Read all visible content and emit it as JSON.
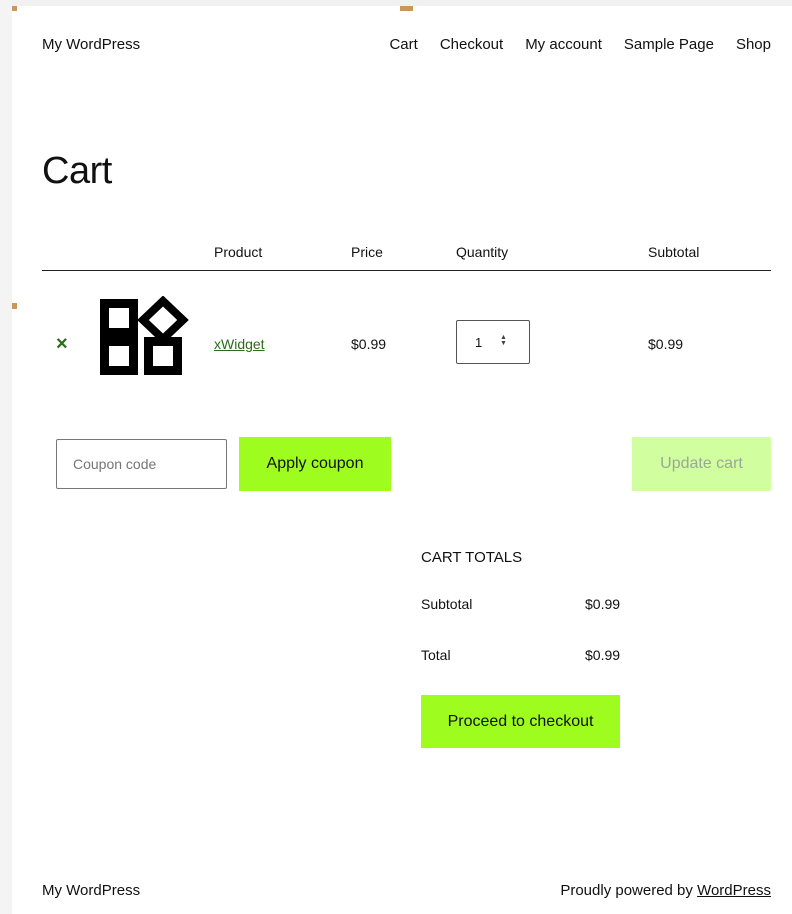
{
  "header": {
    "site_title": "My WordPress",
    "nav": [
      "Cart",
      "Checkout",
      "My account",
      "Sample Page",
      "Shop"
    ]
  },
  "page": {
    "title": "Cart"
  },
  "cart_table": {
    "columns": [
      "Product",
      "Price",
      "Quantity",
      "Subtotal"
    ],
    "items": [
      {
        "remove": "×",
        "name": "xWidget",
        "price": "$0.99",
        "quantity": "1",
        "subtotal": "$0.99"
      }
    ]
  },
  "coupon": {
    "placeholder": "Coupon code",
    "apply_label": "Apply coupon"
  },
  "update_cart_label": "Update cart",
  "cart_totals": {
    "heading": "CART TOTALS",
    "subtotal_label": "Subtotal",
    "subtotal_value": "$0.99",
    "total_label": "Total",
    "total_value": "$0.99",
    "checkout_label": "Proceed to checkout"
  },
  "footer": {
    "site_title": "My WordPress",
    "powered_prefix": "Proudly powered by ",
    "powered_link": "WordPress"
  },
  "colors": {
    "accent": "#9efc1f",
    "accent_disabled": "#d1fe9f",
    "link": "#2a6b1d"
  }
}
